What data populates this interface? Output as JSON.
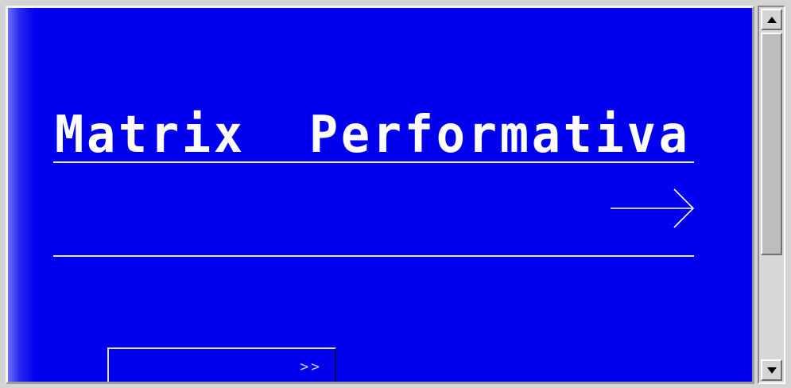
{
  "page": {
    "title": "Matrix  Performativa",
    "next_label": ">>"
  },
  "icons": {
    "arrow": "right-arrow-icon",
    "scroll_up": "triangle-up-icon",
    "scroll_down": "triangle-down-icon"
  },
  "colors": {
    "background": "#0000ee",
    "text": "#ffffff",
    "chrome": "#d4d4d4"
  }
}
